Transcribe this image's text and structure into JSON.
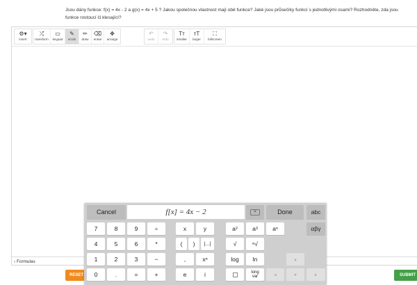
{
  "question": "Jsou dány funkce: f(x) = 4x - 2 a g(x) = 4x + 5 ? Jakou společnou vlastnost mají obě funkce? Jaké jsou průsečíky funkcí s jednotlivými osami? Rozhodněte, zda jsou funkce rostoucí či klesající?",
  "toolbar": {
    "items": [
      {
        "label": "insert",
        "icon": "⚙▾"
      },
      {
        "label": "transform",
        "icon": "⤮"
      },
      {
        "label": "keypad",
        "icon": "▭"
      },
      {
        "label": "scrub",
        "icon": "✎"
      },
      {
        "label": "draw",
        "icon": "✏"
      },
      {
        "label": "erase",
        "icon": "⌫"
      },
      {
        "label": "arrange",
        "icon": "✥"
      },
      {
        "label": "undo",
        "icon": "↶"
      },
      {
        "label": "redo",
        "icon": "↷"
      },
      {
        "label": "smaller",
        "icon": "Tт"
      },
      {
        "label": "larger",
        "icon": "тT"
      },
      {
        "label": "fullscreen",
        "icon": "⛶"
      }
    ]
  },
  "formulas_label": "Formulas",
  "reset_label": "RESET",
  "submit_label": "SUBMIT",
  "keypad": {
    "cancel": "Cancel",
    "display": "f[x] = 4x − 2",
    "backspace": "⌫",
    "done": "Done",
    "abc": "abc",
    "greek": "αβγ",
    "digits": {
      "k7": "7",
      "k8": "8",
      "k9": "9",
      "k4": "4",
      "k5": "5",
      "k6": "6",
      "k1": "1",
      "k2": "2",
      "k3": "3",
      "k0": "0"
    },
    "ops": {
      "div": "÷",
      "mul": "*",
      "minus": "−",
      "plus": "+",
      "dot": ".",
      "eq": "=",
      "comma": ","
    },
    "vars": {
      "x": "x",
      "y": "y",
      "e": "e",
      "i": "i",
      "lparen": "(",
      "rparen": ")",
      "abs": "|...|",
      "xn": "x",
      "xn_sub": "n"
    },
    "funcs": {
      "a2": "a",
      "a2_sup": "2",
      "a3": "a",
      "a3_sup": "3",
      "an": "a",
      "an_sup": "n",
      "sqrt": "√",
      "nroot": "ⁿ√",
      "log": "log",
      "ln": "ln",
      "long1": "long",
      "long2": "var"
    },
    "arrows": {
      "up": "▵",
      "left": "◃",
      "down": "▿",
      "right": "▹"
    }
  }
}
